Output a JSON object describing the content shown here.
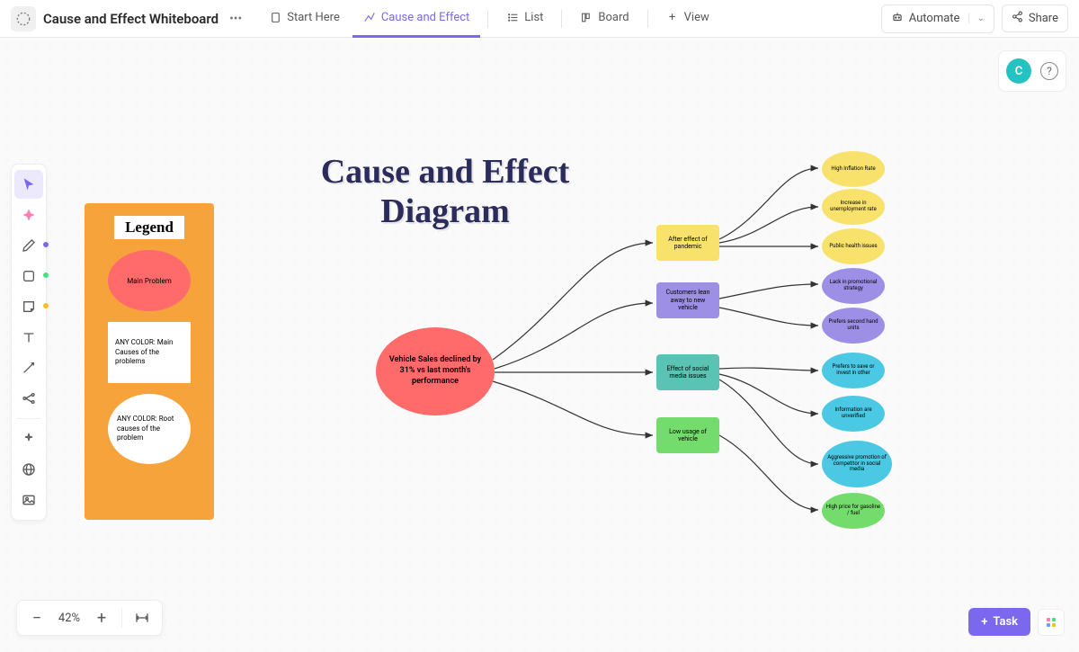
{
  "header": {
    "title": "Cause and Effect Whiteboard",
    "automate": "Automate",
    "share": "Share"
  },
  "tabs": {
    "start": "Start Here",
    "cause": "Cause and Effect",
    "list": "List",
    "board": "Board",
    "view": "View"
  },
  "avatar": {
    "initial": "C"
  },
  "zoom": {
    "value": "42%"
  },
  "task_button": "Task",
  "legend": {
    "title": "Legend",
    "main_problem": "Main Problem",
    "main_causes": "ANY COLOR: Main Causes of the problems",
    "root_causes": "ANY COLOR: Root causes of the problem"
  },
  "diagram": {
    "title": "Cause and Effect Diagram",
    "main_problem": "Vehicle Sales declined by 31% vs last month's performance",
    "causes": {
      "yellow": "After effect of pandemic",
      "purple": "Customers lean away to new vehicle",
      "teal": "Effect of social media issues",
      "green": "Low usage of vehicle"
    },
    "roots": {
      "y1": "High Inflation Rate",
      "y2": "Increase in unemployment rate",
      "y3": "Public health issues",
      "p1": "Lack in promotional strategy",
      "p2": "Prefers second hand units",
      "t1": "Prefers to save or invest in other",
      "t2": "Information are unverified",
      "t3": "Aggressive promotion of competitor in social media",
      "g1": "High price for gasoline / fuel"
    }
  },
  "colors": {
    "accent": "#7b68ee",
    "red": "#ff6a6a",
    "orange": "#f6a33c",
    "yellow": "#f9e26b",
    "purple": "#9d8fe6",
    "teal": "#5bc3b4",
    "green": "#74dc6c"
  }
}
